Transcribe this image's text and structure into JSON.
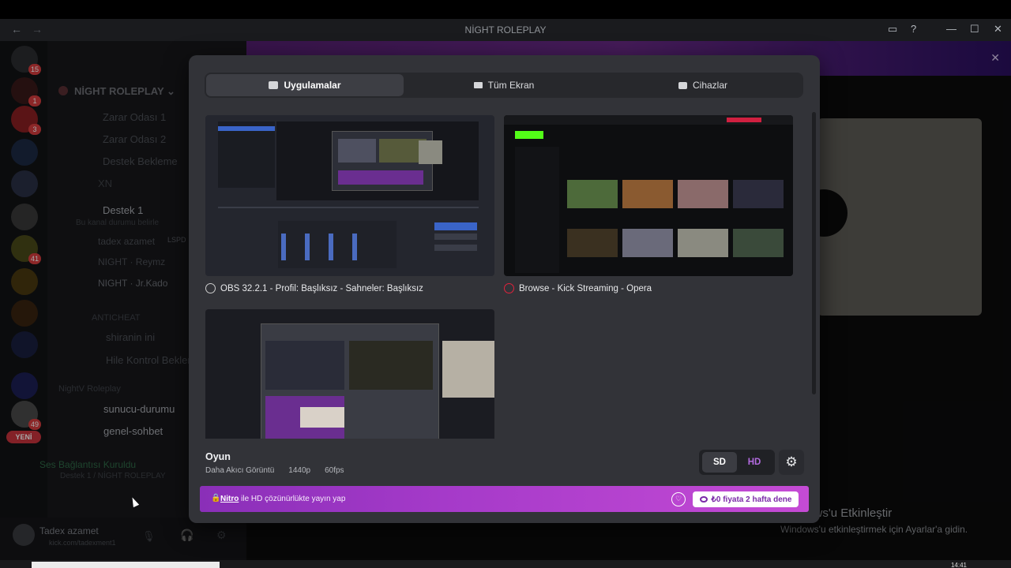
{
  "window": {
    "title": "NİGHT ROLEPLAY"
  },
  "banner": {},
  "rail": {
    "badges": [
      "15",
      "1",
      "3",
      "41",
      "49"
    ],
    "new_label": "YENİ"
  },
  "sidebar": {
    "server_name": "NİGHT ROLEPLAY",
    "channels": [
      {
        "label": "Zarar Odası 1"
      },
      {
        "label": "Zarar Odası 2"
      },
      {
        "label": "Destek Bekleme"
      },
      {
        "label": "XN"
      },
      {
        "label": "Destek 1"
      },
      {
        "label": "Bu kanal durumu belirle"
      },
      {
        "label": "tadex azamet"
      },
      {
        "label": "NIGHT · Reymz"
      },
      {
        "label": "NIGHT · Jr.Kado"
      },
      {
        "label": "ANTICHEAT"
      },
      {
        "label": "shiranin ini"
      },
      {
        "label": "Hile Kontrol Bekleme"
      },
      {
        "label": "NightV Roleplay"
      },
      {
        "label": "sunucu-durumu"
      },
      {
        "label": "genel-sohbet"
      }
    ],
    "lspd_tag": "LSPD",
    "voice_status": "Ses Bağlantısı Kuruldu",
    "voice_channel": "Destek 1 / NİGHT ROLEPLAY",
    "user_name": "Tadex azamet",
    "user_status": "kick.com/tadexment1"
  },
  "modal": {
    "tabs": [
      {
        "label": "Uygulamalar",
        "icon": "app-window-icon",
        "active": true
      },
      {
        "label": "Tüm Ekran",
        "icon": "monitor-icon",
        "active": false
      },
      {
        "label": "Cihazlar",
        "icon": "camera-icon",
        "active": false
      }
    ],
    "sources": [
      {
        "title": "OBS 32.2.1 - Profil: Başlıksız - Sahneler: Başlıksız",
        "icon": "obs-icon"
      },
      {
        "title": "Browse - Kick Streaming - Opera",
        "icon": "opera-icon"
      },
      {
        "title": "",
        "icon": ""
      }
    ],
    "game": {
      "title": "Oyun",
      "subtitle": "Daha Akıcı Görüntü",
      "resolution": "1440p",
      "fps": "60fps"
    },
    "quality": {
      "sd": "SD",
      "hd": "HD",
      "selected": "SD"
    },
    "nitro": {
      "link": "Nitro",
      "text": "ile HD çözünürlükte yayın yap",
      "cta": "₺0 fiyata 2 hafta dene"
    }
  },
  "os": {
    "activate_title": "Windows'u Etkinleştir",
    "activate_sub": "Windows'u etkinleştirmek için Ayarlar'a gidin.",
    "clock": "14:41"
  },
  "colors": {
    "accent": "#a53ac9",
    "modal_bg": "#323338",
    "tab_active": "#3d3e44"
  }
}
